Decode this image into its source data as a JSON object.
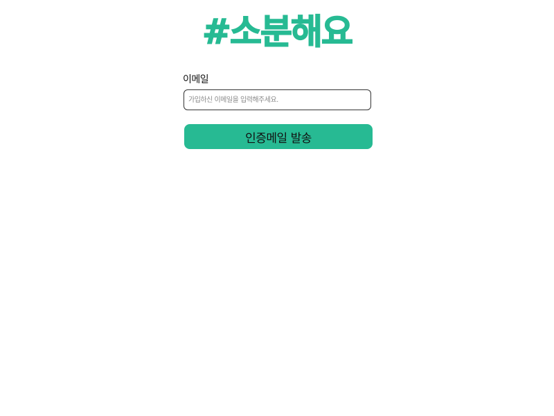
{
  "header": {
    "logo_text": "#소분해요"
  },
  "form": {
    "email_label": "이메일",
    "email_value": "",
    "email_placeholder": "가입하신 이메일을 입력해주세요.",
    "submit_label": "인증메일 발송"
  },
  "colors": {
    "brand": "#27ba93",
    "text": "#111111",
    "input_border": "#333333",
    "placeholder": "#8a8a8a",
    "background": "#ffffff"
  }
}
